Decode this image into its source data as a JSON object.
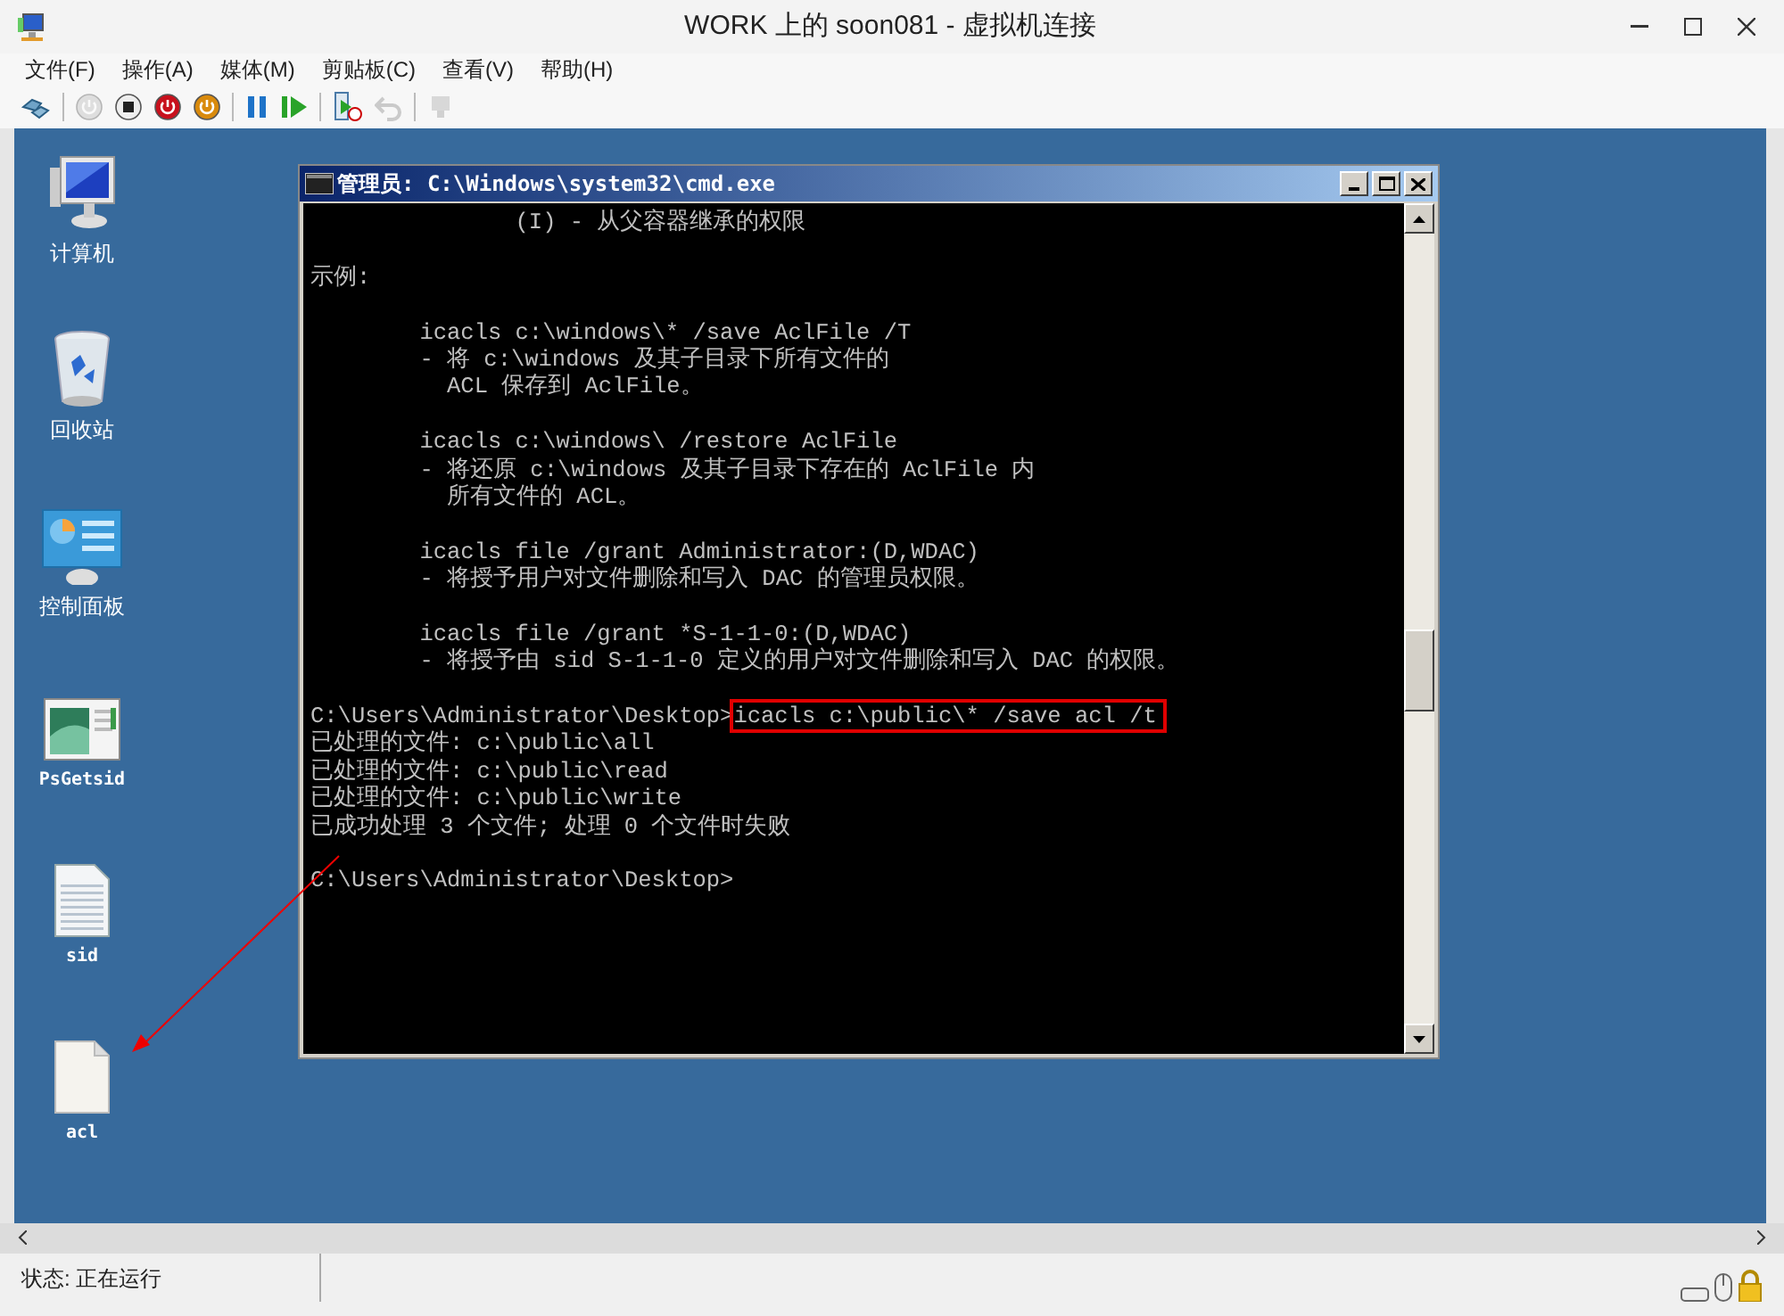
{
  "window": {
    "title": "WORK 上的 soon081 - 虚拟机连接"
  },
  "menu": [
    "文件(F)",
    "操作(A)",
    "媒体(M)",
    "剪贴板(C)",
    "查看(V)",
    "帮助(H)"
  ],
  "toolbar": [
    {
      "kind": "ctrl-alt-del"
    },
    {
      "kind": "sep"
    },
    {
      "kind": "start",
      "disabled": true
    },
    {
      "kind": "turn-off",
      "disabled": false
    },
    {
      "kind": "shutdown",
      "disabled": false
    },
    {
      "kind": "save",
      "disabled": false
    },
    {
      "kind": "sep"
    },
    {
      "kind": "pause",
      "disabled": false
    },
    {
      "kind": "reset",
      "disabled": false
    },
    {
      "kind": "sep"
    },
    {
      "kind": "snapshot",
      "disabled": false
    },
    {
      "kind": "revert",
      "disabled": true
    },
    {
      "kind": "sep"
    },
    {
      "kind": "enhanced",
      "disabled": true
    }
  ],
  "desktop_icons": [
    {
      "kind": "computer",
      "label": "计算机"
    },
    {
      "kind": "recycle-bin",
      "label": "回收站"
    },
    {
      "kind": "control-panel",
      "label": "控制面板"
    },
    {
      "kind": "app",
      "label": "PsGetsid"
    },
    {
      "kind": "text-file",
      "label": "sid"
    },
    {
      "kind": "blank-file",
      "label": "acl"
    }
  ],
  "console": {
    "title": "管理员: C:\\Windows\\system32\\cmd.exe",
    "lines": [
      {
        "kind": "text",
        "text": "               (I) - 从父容器继承的权限"
      },
      {
        "kind": "blank"
      },
      {
        "kind": "text",
        "text": "示例:"
      },
      {
        "kind": "blank"
      },
      {
        "kind": "text",
        "text": "        icacls c:\\windows\\* /save AclFile /T"
      },
      {
        "kind": "text",
        "text": "        - 将 c:\\windows 及其子目录下所有文件的"
      },
      {
        "kind": "text",
        "text": "          ACL 保存到 AclFile。"
      },
      {
        "kind": "blank"
      },
      {
        "kind": "text",
        "text": "        icacls c:\\windows\\ /restore AclFile"
      },
      {
        "kind": "text",
        "text": "        - 将还原 c:\\windows 及其子目录下存在的 AclFile 内"
      },
      {
        "kind": "text",
        "text": "          所有文件的 ACL。"
      },
      {
        "kind": "blank"
      },
      {
        "kind": "text",
        "text": "        icacls file /grant Administrator:(D,WDAC)"
      },
      {
        "kind": "text",
        "text": "        - 将授予用户对文件删除和写入 DAC 的管理员权限。"
      },
      {
        "kind": "blank"
      },
      {
        "kind": "text",
        "text": "        icacls file /grant *S-1-1-0:(D,WDAC)"
      },
      {
        "kind": "text",
        "text": "        - 将授予由 sid S-1-1-0 定义的用户对文件删除和写入 DAC 的权限。"
      },
      {
        "kind": "blank"
      },
      {
        "kind": "command",
        "prompt": "C:\\Users\\Administrator\\Desktop>",
        "command": "icacls c:\\public\\* /save acl /t",
        "highlighted": true
      },
      {
        "kind": "text",
        "text": "已处理的文件: c:\\public\\all"
      },
      {
        "kind": "text",
        "text": "已处理的文件: c:\\public\\read"
      },
      {
        "kind": "text",
        "text": "已处理的文件: c:\\public\\write"
      },
      {
        "kind": "text",
        "text": "已成功处理 3 个文件; 处理 0 个文件时失败"
      },
      {
        "kind": "blank"
      },
      {
        "kind": "text",
        "text": "C:\\Users\\Administrator\\Desktop>"
      }
    ]
  },
  "status_bar": {
    "status": "状态: 正在运行"
  }
}
